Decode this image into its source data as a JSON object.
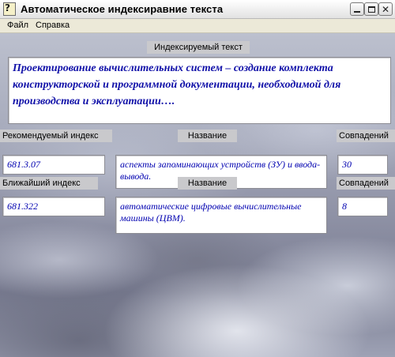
{
  "window": {
    "title": "Автоматическое индексиравние текста",
    "icon_glyph": "?"
  },
  "menu": {
    "file": "Файл",
    "help": "Справка"
  },
  "indexed_text": {
    "label": "Индексируемый текст",
    "value": "Проектирование вычислительных систем – создание комплекта конструкторской и программной документации, необходимой для производства и эксплуатации…."
  },
  "recommended": {
    "index_label": "Рекомендуемый индекс",
    "name_label": "Название",
    "matches_label": "Совпадений",
    "index_value": "681.3.07",
    "name_value": "аспекты запоминающих устройств (ЗУ) и ввода- вывода.",
    "matches_value": "30"
  },
  "nearest": {
    "index_label": "Ближайший индекс",
    "name_label": "Название",
    "matches_label": "Совпадений",
    "index_value": "681.322",
    "name_value": "автоматические цифровые вычислительные машины (ЦВМ).",
    "matches_value": "8"
  },
  "icons": {
    "app": "app-icon",
    "minimize": "minimize-icon",
    "maximize": "maximize-icon",
    "close": "close-icon"
  }
}
